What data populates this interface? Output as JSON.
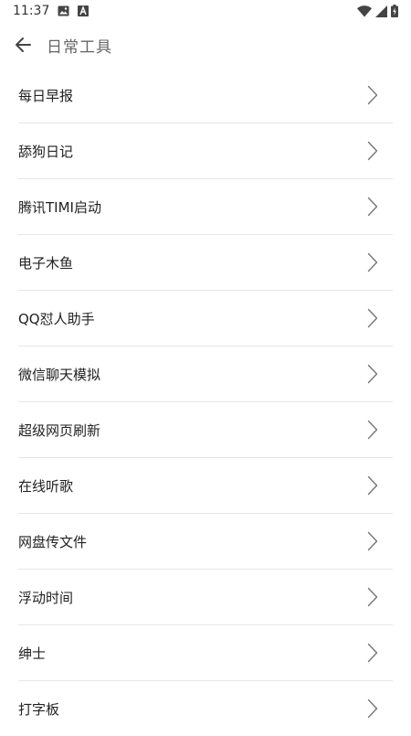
{
  "status_bar": {
    "time": "11:37",
    "icons": [
      "image-icon",
      "a-notification-icon",
      "wifi-icon",
      "cell-signal-icon",
      "battery-charging-icon"
    ]
  },
  "header": {
    "back_icon": "arrow-left-icon",
    "title": "日常工具"
  },
  "list": {
    "chevron_icon": "chevron-right-icon",
    "items": [
      {
        "label": "每日早报"
      },
      {
        "label": "舔狗日记"
      },
      {
        "label": "腾讯TIMI启动"
      },
      {
        "label": "电子木鱼"
      },
      {
        "label": "QQ怼人助手"
      },
      {
        "label": "微信聊天模拟"
      },
      {
        "label": "超级网页刷新"
      },
      {
        "label": "在线听歌"
      },
      {
        "label": "网盘传文件"
      },
      {
        "label": "浮动时间"
      },
      {
        "label": "绅士"
      },
      {
        "label": "打字板"
      }
    ]
  },
  "colors": {
    "background": "#ffffff",
    "title_text": "#666666",
    "item_text": "#222222",
    "divider": "#e6e6e6",
    "chevron": "#777777"
  }
}
